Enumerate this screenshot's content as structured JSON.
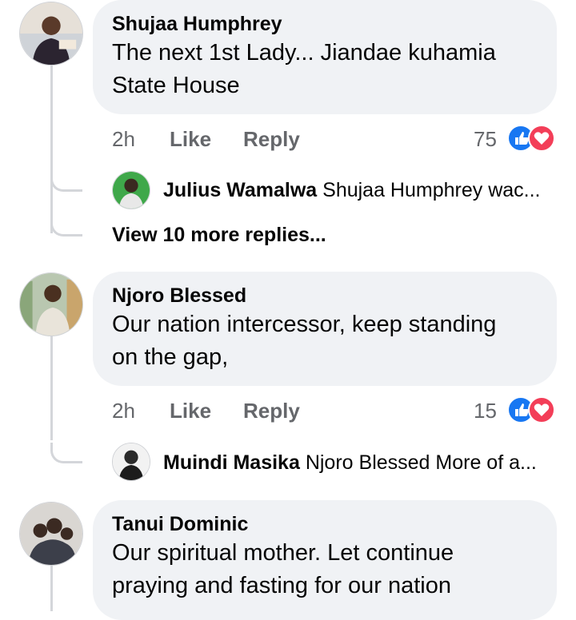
{
  "comments": [
    {
      "author": "Shujaa Humphrey",
      "text_line1": "The next 1st Lady... Jiandae kuhamia",
      "text_line2": "State House",
      "time": "2h",
      "like_label": "Like",
      "reply_label": "Reply",
      "reaction_count": "75",
      "reactions": [
        "like-icon",
        "love-icon"
      ],
      "replies": [
        {
          "author": "Julius Wamalwa",
          "snippet": "Shujaa Humphrey wac..."
        }
      ],
      "view_more": "View 10 more replies..."
    },
    {
      "author": "Njoro Blessed",
      "text_line1": "Our nation intercessor, keep standing",
      "text_line2": "on the gap,",
      "time": "2h",
      "like_label": "Like",
      "reply_label": "Reply",
      "reaction_count": "15",
      "reactions": [
        "like-icon",
        "love-icon"
      ],
      "replies": [
        {
          "author": "Muindi Masika",
          "snippet": "Njoro Blessed More of a..."
        }
      ]
    },
    {
      "author": "Tanui Dominic",
      "text_line1": "Our spiritual mother. Let continue",
      "text_line2": "praying and fasting for our nation"
    }
  ],
  "colors": {
    "bubble": "#f0f2f5",
    "meta": "#65676b",
    "like_blue": "#1877f2",
    "love_red": "#f33e58",
    "thread_line": "#d4d6da"
  }
}
